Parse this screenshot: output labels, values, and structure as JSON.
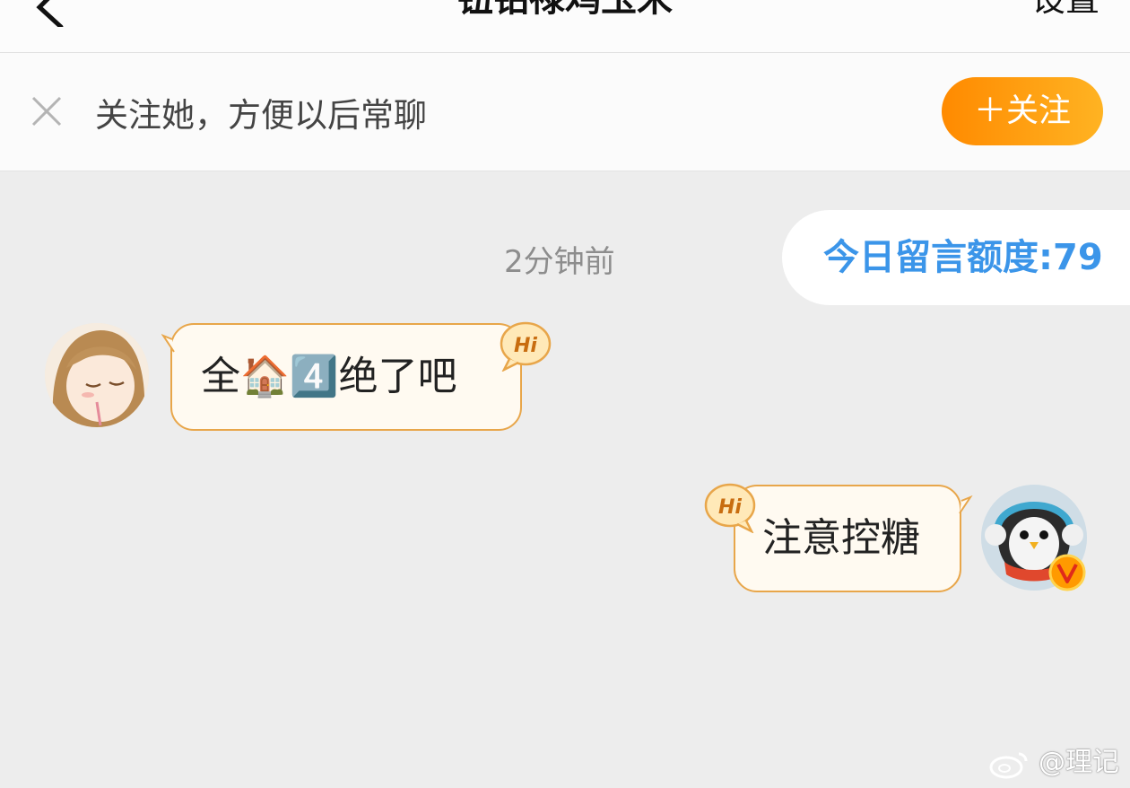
{
  "nav": {
    "title": "钮钴禄鸡玉米",
    "settings_label": "设置"
  },
  "follow_bar": {
    "prompt": "关注她，方便以后常聊",
    "follow_button": "＋关注"
  },
  "quota": {
    "label": "今日留言额度:79"
  },
  "chat": {
    "timestamp": "2分钟前",
    "messages": [
      {
        "side": "left",
        "text": "全🏠4️⃣绝了吧",
        "hi_badge": "Hi"
      },
      {
        "side": "right",
        "text": "注意控糖",
        "hi_badge": "Hi"
      }
    ]
  },
  "watermark": "@理记",
  "colors": {
    "accent_orange": "#ff8a00",
    "quota_blue": "#3b95e9",
    "bubble_border": "#e8a64a"
  }
}
